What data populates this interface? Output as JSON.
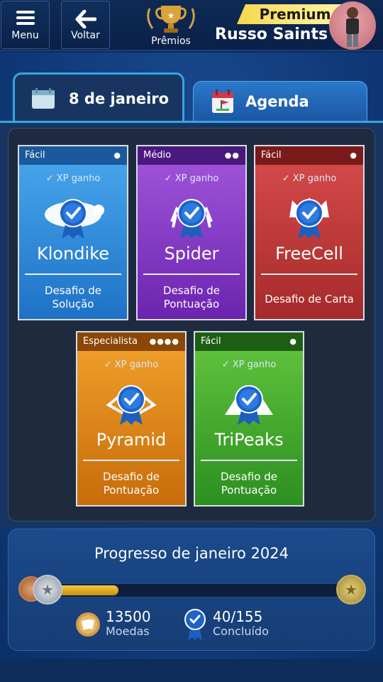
{
  "header": {
    "menu_label": "Menu",
    "back_label": "Voltar",
    "awards_label": "Prêmios",
    "premium_label": "Premium",
    "username": "Russo Saints"
  },
  "tabs": [
    {
      "label": "8 de janeiro",
      "active": true
    },
    {
      "label": "Agenda",
      "active": false
    }
  ],
  "cards": [
    {
      "difficulty": "Fácil",
      "dots": "●",
      "xp": "✓ XP ganho",
      "game": "Klondike",
      "challenge_line1": "Desafio de",
      "challenge_line2": "Solução",
      "color": "#2e8bd9"
    },
    {
      "difficulty": "Médio",
      "dots": "●●",
      "xp": "✓ XP ganho",
      "game": "Spider",
      "challenge_line1": "Desafio de",
      "challenge_line2": "Pontuação",
      "color": "#8a3fcd"
    },
    {
      "difficulty": "Fácil",
      "dots": "●",
      "xp": "✓ XP ganho",
      "game": "FreeCell",
      "challenge_line1": "Desafio de Carta",
      "challenge_line2": "",
      "color": "#c23b3b"
    },
    {
      "difficulty": "Especialista",
      "dots": "●●●●",
      "xp": "✓ XP ganho",
      "game": "Pyramid",
      "challenge_line1": "Desafio de",
      "challenge_line2": "Pontuação",
      "color": "#e08a1c"
    },
    {
      "difficulty": "Fácil",
      "dots": "●",
      "xp": "✓ XP ganho",
      "game": "TriPeaks",
      "challenge_line1": "Desafio de",
      "challenge_line2": "Pontuação",
      "color": "#45aa30"
    }
  ],
  "progress": {
    "title": "Progresso de janeiro 2024",
    "fraction": 0.26,
    "coins_value": "13500",
    "coins_label": "Moedas",
    "completed_value": "40/155",
    "completed_label": "Concluído"
  }
}
